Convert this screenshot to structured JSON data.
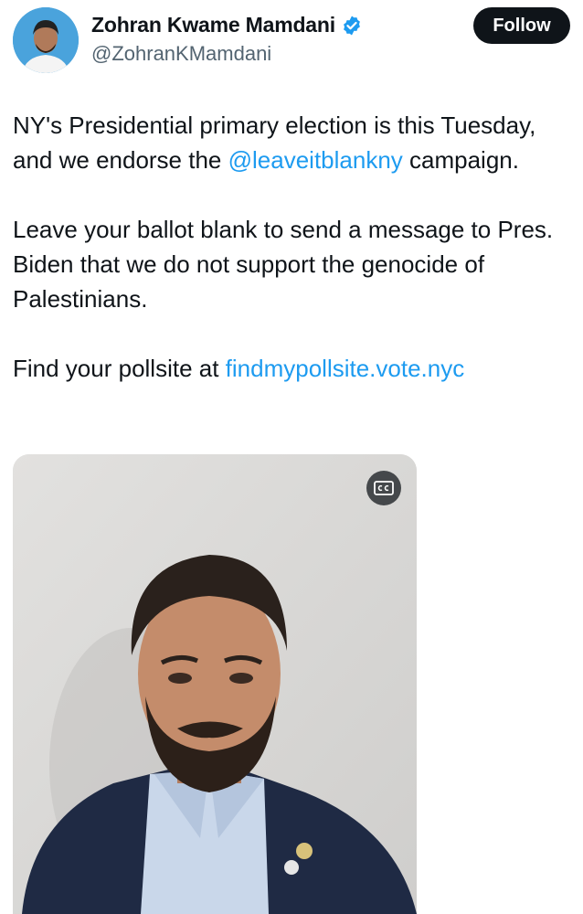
{
  "author": {
    "display_name": "Zohran Kwame Mamdani",
    "handle": "@ZohranKMamdani",
    "verified": true,
    "avatar_icon": "profile-photo"
  },
  "follow_button": {
    "label": "Follow"
  },
  "tweet": {
    "paragraphs": [
      {
        "before": "NY's Presidential primary election is this Tuesday, and we endorse the ",
        "link": "@leaveitblankny",
        "after": " campaign."
      },
      {
        "text": "Leave your ballot blank to send a message to Pres. Biden that we do not support the genocide of Palestinians."
      },
      {
        "before": "Find your pollsite at ",
        "link": "findmypollsite.vote.nyc"
      }
    ]
  },
  "media": {
    "type": "video",
    "captions_icon": "closed-captions-icon"
  },
  "colors": {
    "link": "#1d9bf0",
    "verified": "#1d9bf0",
    "follow_bg": "#0f1419",
    "text": "#0f1419",
    "secondary": "#536471"
  }
}
